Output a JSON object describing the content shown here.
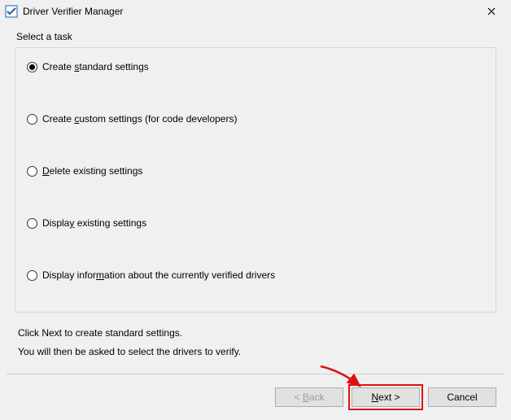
{
  "titlebar": {
    "title": "Driver Verifier Manager"
  },
  "group": {
    "label": "Select a task",
    "options": [
      {
        "pre": "Create ",
        "mnemonic": "s",
        "post": "tandard settings",
        "checked": true
      },
      {
        "pre": "Create ",
        "mnemonic": "c",
        "post": "ustom settings (for code developers)",
        "checked": false
      },
      {
        "pre": "",
        "mnemonic": "D",
        "post": "elete existing settings",
        "checked": false
      },
      {
        "pre": "Displa",
        "mnemonic": "y",
        "post": " existing settings",
        "checked": false
      },
      {
        "pre": "Display infor",
        "mnemonic": "m",
        "post": "ation about the currently verified drivers",
        "checked": false
      }
    ]
  },
  "hints": {
    "line1": "Click Next to create standard settings.",
    "line2": "You will then be asked to select the drivers to verify."
  },
  "buttons": {
    "back_pre": "< ",
    "back_mnemonic": "B",
    "back_post": "ack",
    "next_mnemonic": "N",
    "next_post": "ext >",
    "cancel": "Cancel"
  }
}
